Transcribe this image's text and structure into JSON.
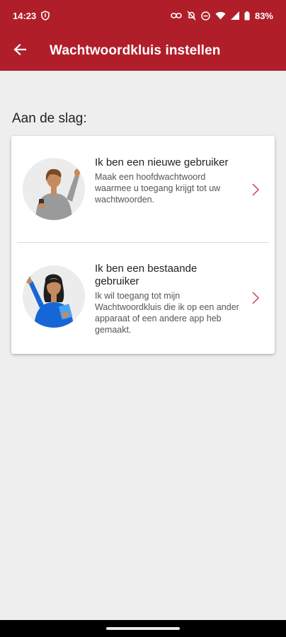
{
  "status_bar": {
    "time": "14:23",
    "battery": "83%",
    "icons": [
      "shield-icon",
      "link-icon",
      "bell-off-icon",
      "dnd-icon",
      "wifi-icon",
      "signal-icon",
      "battery-icon"
    ]
  },
  "toolbar": {
    "title": "Wachtwoordkluis instellen",
    "back_icon": "arrow-left-icon"
  },
  "section": {
    "label": "Aan de slag:"
  },
  "options": [
    {
      "title": "Ik ben een nieuwe gebruiker",
      "description": "Maak een hoofdwachtwoord waarmee u toegang krijgt tot uw wachtwoorden."
    },
    {
      "title": "Ik ben een bestaande gebruiker",
      "description": "Ik wil toegang tot mijn Wachtwoordkluis die ik op een ander apparaat of een andere app heb gemaakt."
    }
  ],
  "colors": {
    "brand": "#b01e2a",
    "background": "#eeeeee",
    "chevron": "#c0393f"
  }
}
